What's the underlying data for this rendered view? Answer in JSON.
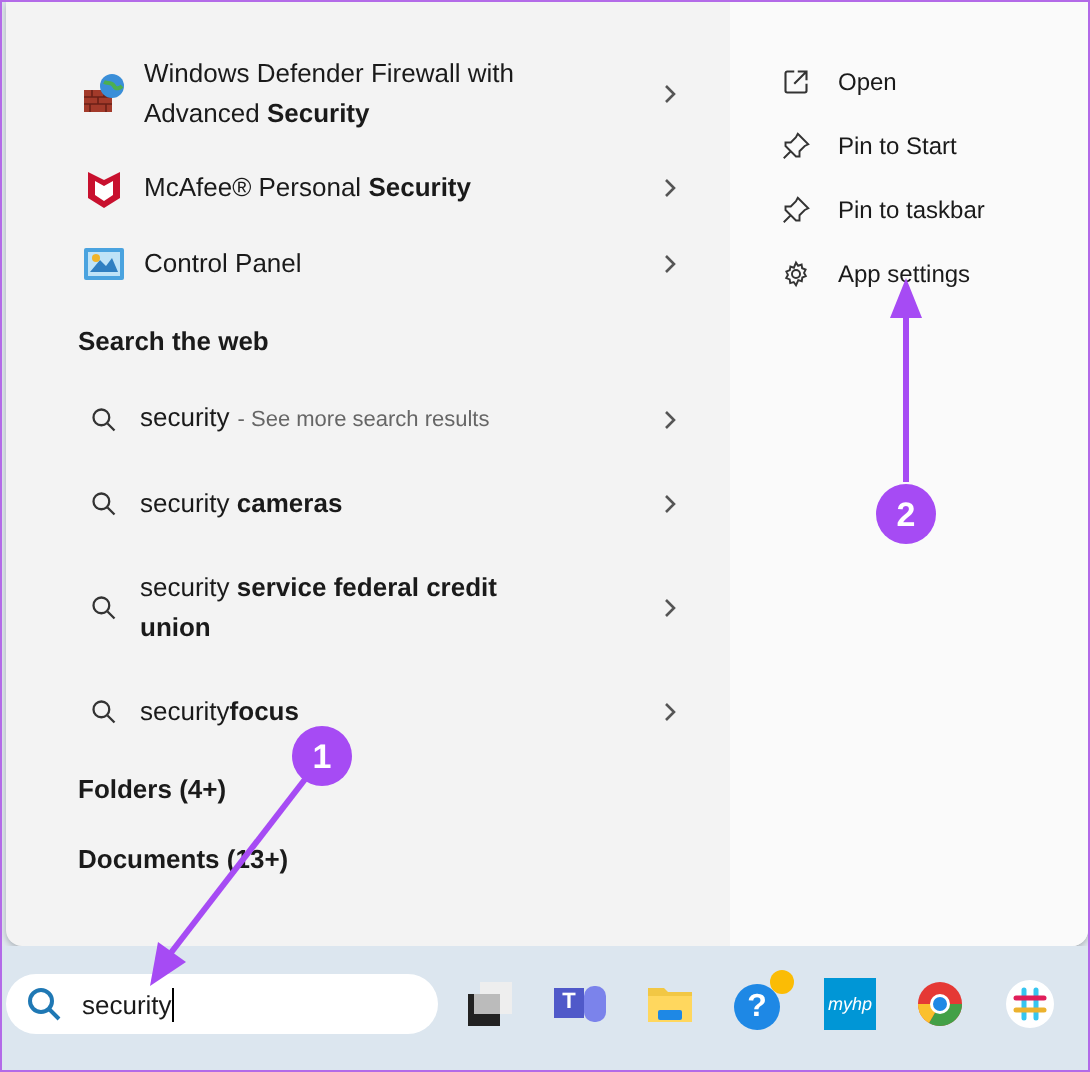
{
  "best_matches": [
    {
      "kind": "firewall",
      "text": "Windows Defender Firewall with Advanced **Security**"
    },
    {
      "kind": "mcafee",
      "text": "McAfee® Personal **Security**"
    },
    {
      "kind": "control-panel",
      "text": "Control Panel"
    }
  ],
  "web_heading": "Search the web",
  "web_results": [
    {
      "text": "security",
      "hint": "- See more search results"
    },
    {
      "text": "security **cameras**"
    },
    {
      "text": "security **service federal credit union**"
    },
    {
      "text": "security**focus**"
    }
  ],
  "sections": [
    "Folders (4+)",
    "Documents (13+)"
  ],
  "actions": [
    {
      "kind": "open",
      "label": "Open"
    },
    {
      "kind": "pin",
      "label": "Pin to Start"
    },
    {
      "kind": "pin",
      "label": "Pin to taskbar"
    },
    {
      "kind": "settings",
      "label": "App settings"
    }
  ],
  "search": {
    "value": "security"
  },
  "taskbar": [
    {
      "kind": "task-view"
    },
    {
      "kind": "teams",
      "label": "T"
    },
    {
      "kind": "folder"
    },
    {
      "kind": "help",
      "label": "?"
    },
    {
      "kind": "hp",
      "label": "myhp"
    },
    {
      "kind": "chrome"
    },
    {
      "kind": "slack"
    }
  ],
  "annotations": [
    {
      "number": "1"
    },
    {
      "number": "2"
    }
  ]
}
